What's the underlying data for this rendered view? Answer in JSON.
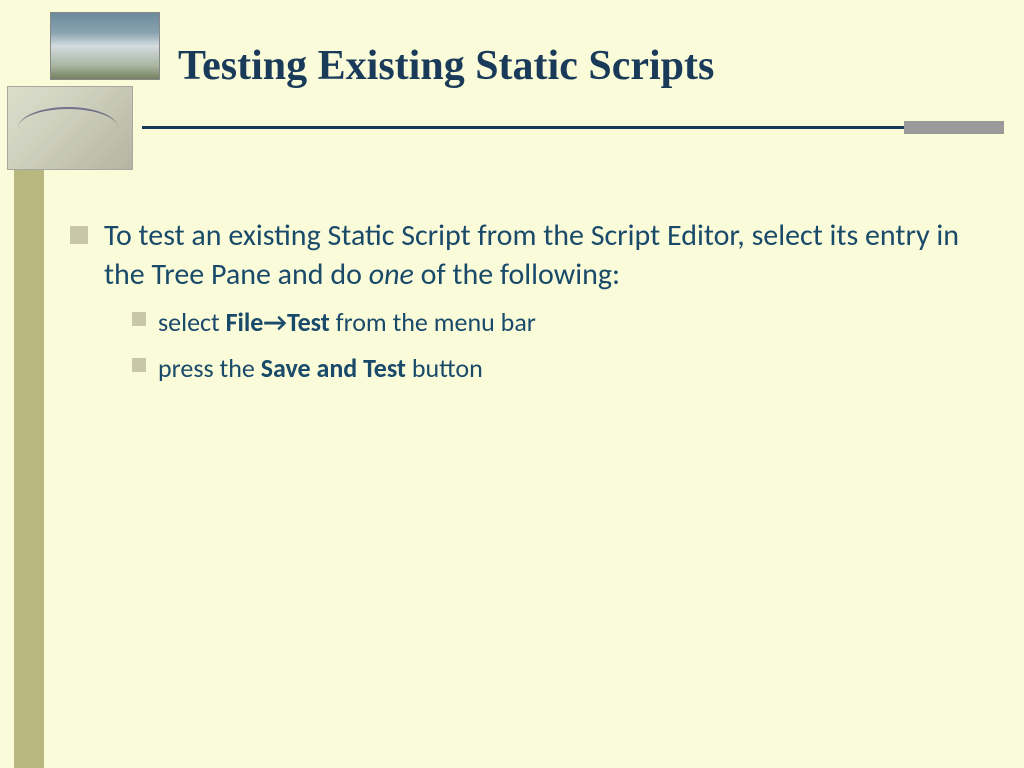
{
  "title": "Testing Existing Static Scripts",
  "main_bullet": {
    "pre": "To test an existing Static Script from the Script Editor, select its entry in the Tree Pane and do ",
    "em": "one",
    "post": " of the following:"
  },
  "sub_bullets": [
    {
      "pre": "select ",
      "bold1": "File",
      "arrow": "→",
      "bold2": "Test",
      "post": " from the menu bar"
    },
    {
      "pre": "press the ",
      "bold1": "Save and Test",
      "post": " button"
    }
  ]
}
